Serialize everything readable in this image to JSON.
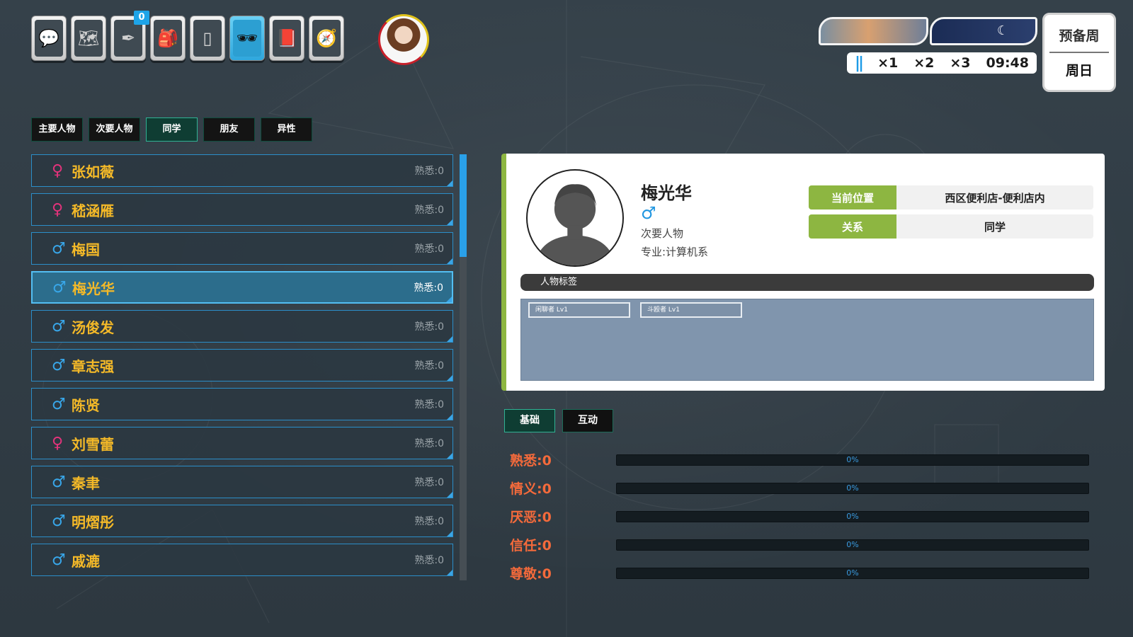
{
  "toolbar": {
    "items": [
      {
        "name": "chat",
        "glyph": "💬"
      },
      {
        "name": "map",
        "glyph": "🗺"
      },
      {
        "name": "pen",
        "glyph": "✒"
      },
      {
        "name": "backpack",
        "glyph": "🎒"
      },
      {
        "name": "phone",
        "glyph": "▯"
      },
      {
        "name": "glasses",
        "glyph": "🕶"
      },
      {
        "name": "book",
        "glyph": "📕"
      },
      {
        "name": "compass",
        "glyph": "🧭"
      }
    ],
    "badge": "0"
  },
  "time": {
    "pause": "||",
    "speed1": "×1",
    "speed2": "×2",
    "speed3": "×3",
    "clock": "09:48",
    "moon": "☾"
  },
  "calendar": {
    "week": "预备周",
    "day": "周日"
  },
  "filters": [
    "主要人物",
    "次要人物",
    "同学",
    "朋友",
    "异性"
  ],
  "characters": [
    {
      "gender": "♀",
      "name": "张如薇",
      "familiarity": "熟悉:0"
    },
    {
      "gender": "♀",
      "name": "嵇涵雁",
      "familiarity": "熟悉:0"
    },
    {
      "gender": "♂",
      "name": "梅国",
      "familiarity": "熟悉:0"
    },
    {
      "gender": "♂",
      "name": "梅光华",
      "familiarity": "熟悉:0"
    },
    {
      "gender": "♂",
      "name": "汤俊发",
      "familiarity": "熟悉:0"
    },
    {
      "gender": "♂",
      "name": "章志强",
      "familiarity": "熟悉:0"
    },
    {
      "gender": "♂",
      "name": "陈贤",
      "familiarity": "熟悉:0"
    },
    {
      "gender": "♀",
      "name": "刘雪蕾",
      "familiarity": "熟悉:0"
    },
    {
      "gender": "♂",
      "name": "秦聿",
      "familiarity": "熟悉:0"
    },
    {
      "gender": "♂",
      "name": "明熠彤",
      "familiarity": "熟悉:0"
    },
    {
      "gender": "♂",
      "name": "戚漉",
      "familiarity": "熟悉:0"
    }
  ],
  "detail": {
    "name": "梅光华",
    "gender": "♂",
    "role": "次要人物",
    "major": "专业:计算机系",
    "location_label": "当前位置",
    "location_value": "西区便利店-便利店内",
    "relation_label": "关系",
    "relation_value": "同学",
    "tags_header": "人物标签",
    "tags": [
      "闲聊者 Lv1",
      "斗殴者 Lv1"
    ]
  },
  "subtabs": [
    "基础",
    "互动"
  ],
  "stats": [
    {
      "label": "熟悉:0",
      "value": 0,
      "percent": "0%"
    },
    {
      "label": "情义:0",
      "value": 0,
      "percent": "0%"
    },
    {
      "label": "厌恶:0",
      "value": 0,
      "percent": "0%"
    },
    {
      "label": "信任:0",
      "value": 0,
      "percent": "0%"
    },
    {
      "label": "尊敬:0",
      "value": 0,
      "percent": "0%"
    }
  ],
  "colors": {
    "accent_green": "#8db641",
    "accent_blue": "#2aa0e8",
    "name_gold": "#f4b928",
    "stat_orange": "#f46a3b",
    "female_pink": "#e3337b",
    "male_blue": "#38a7ea"
  }
}
